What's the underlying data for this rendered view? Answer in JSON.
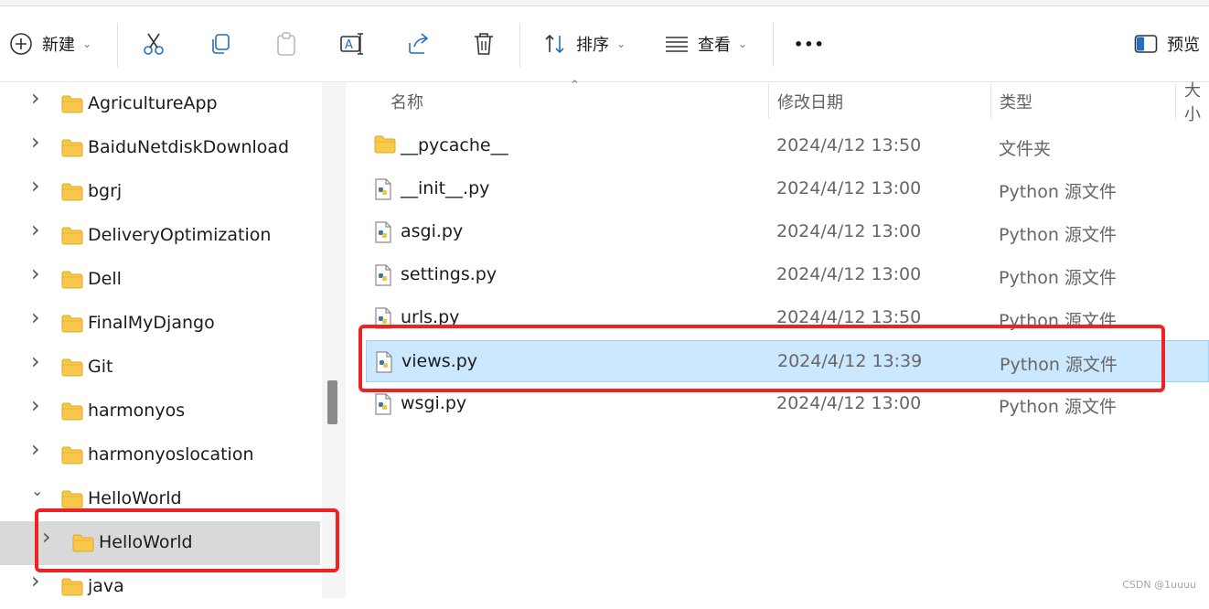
{
  "toolbar": {
    "new_label": "新建",
    "sort_label": "排序",
    "view_label": "查看",
    "more_label": "•••",
    "preview_label": "预览"
  },
  "nav": {
    "items": [
      {
        "label": "AgricultureApp"
      },
      {
        "label": "BaiduNetdiskDownload"
      },
      {
        "label": "bgrj"
      },
      {
        "label": "DeliveryOptimization"
      },
      {
        "label": "Dell"
      },
      {
        "label": "FinalMyDjango"
      },
      {
        "label": "Git"
      },
      {
        "label": "harmonyos"
      },
      {
        "label": "harmonyoslocation"
      },
      {
        "label": "HelloWorld"
      },
      {
        "label": "HelloWorld"
      },
      {
        "label": "java"
      }
    ]
  },
  "columns": {
    "name": "名称",
    "date": "修改日期",
    "type": "类型",
    "size": "大小"
  },
  "files": [
    {
      "name": "__pycache__",
      "date": "2024/4/12 13:50",
      "type": "文件夹",
      "icon": "folder-icon"
    },
    {
      "name": "__init__.py",
      "date": "2024/4/12 13:00",
      "type": "Python 源文件",
      "icon": "python-file-icon"
    },
    {
      "name": "asgi.py",
      "date": "2024/4/12 13:00",
      "type": "Python 源文件",
      "icon": "python-file-icon"
    },
    {
      "name": "settings.py",
      "date": "2024/4/12 13:00",
      "type": "Python 源文件",
      "icon": "python-file-icon"
    },
    {
      "name": "urls.py",
      "date": "2024/4/12 13:50",
      "type": "Python 源文件",
      "icon": "python-file-icon"
    },
    {
      "name": "views.py",
      "date": "2024/4/12 13:39",
      "type": "Python 源文件",
      "icon": "python-file-icon"
    },
    {
      "name": "wsgi.py",
      "date": "2024/4/12 13:00",
      "type": "Python 源文件",
      "icon": "python-file-icon"
    }
  ],
  "watermark": "CSDN @1uuuu",
  "colors": {
    "selection": "#cce8ff",
    "nav_selected": "#d9d9d9",
    "highlight_box": "#ee2222",
    "folder": "#f8c94a"
  }
}
